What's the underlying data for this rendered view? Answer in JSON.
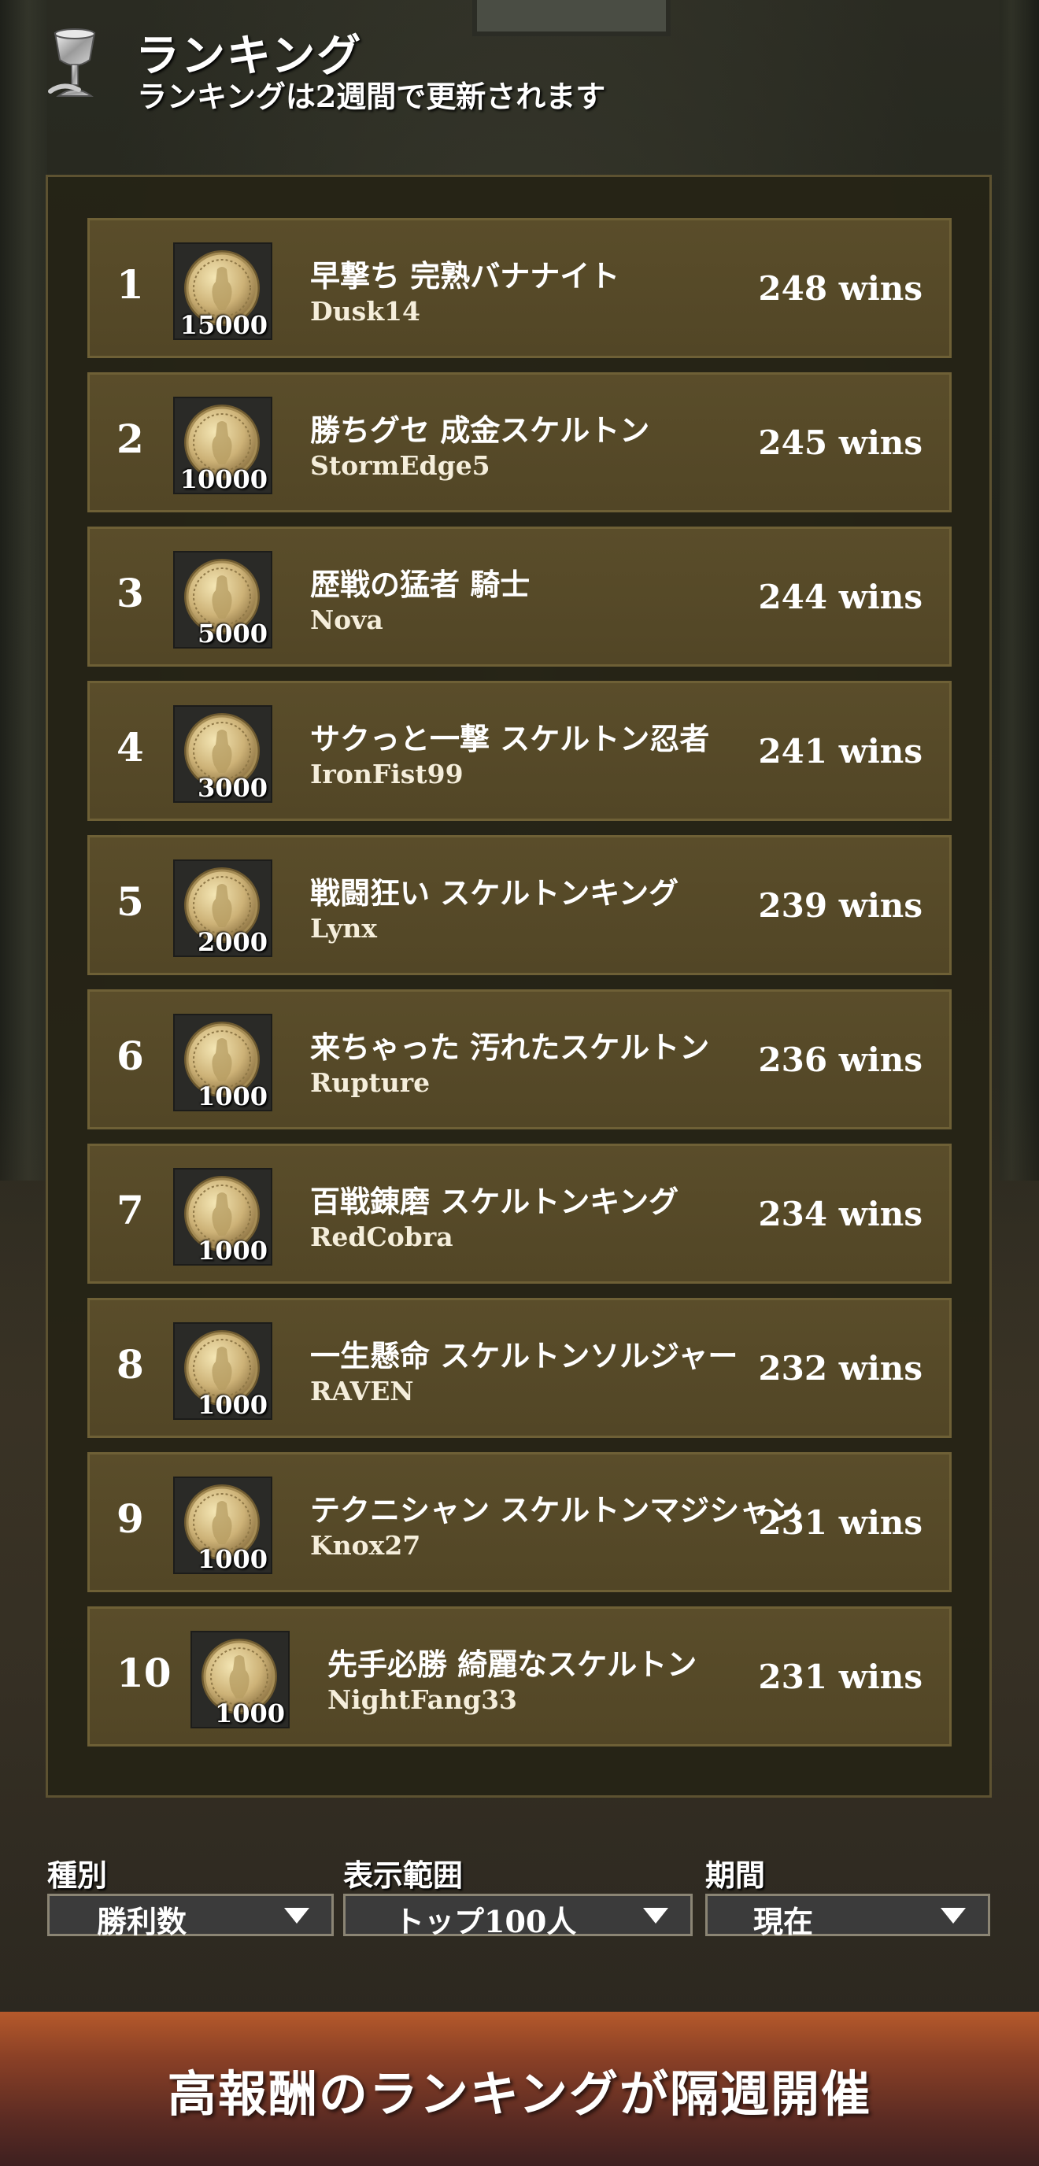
{
  "header": {
    "title": "ランキング",
    "subtitle": "ランキングは2週間で更新されます",
    "icon": "trophy-icon"
  },
  "rankings": [
    {
      "rank": "1",
      "reward": "15000",
      "title": "早撃ち 完熟バナナイト",
      "name": "Dusk14",
      "wins": "248 wins"
    },
    {
      "rank": "2",
      "reward": "10000",
      "title": "勝ちグセ 成金スケルトン",
      "name": "StormEdge5",
      "wins": "245 wins"
    },
    {
      "rank": "3",
      "reward": "5000",
      "title": "歴戦の猛者 騎士",
      "name": "Nova",
      "wins": "244 wins"
    },
    {
      "rank": "4",
      "reward": "3000",
      "title": "サクっと一撃 スケルトン忍者",
      "name": "IronFist99",
      "wins": "241 wins"
    },
    {
      "rank": "5",
      "reward": "2000",
      "title": "戦闘狂い スケルトンキング",
      "name": "Lynx",
      "wins": "239 wins"
    },
    {
      "rank": "6",
      "reward": "1000",
      "title": "来ちゃった 汚れたスケルトン",
      "name": "Rupture",
      "wins": "236 wins"
    },
    {
      "rank": "7",
      "reward": "1000",
      "title": "百戦錬磨 スケルトンキング",
      "name": "RedCobra",
      "wins": "234 wins"
    },
    {
      "rank": "8",
      "reward": "1000",
      "title": "一生懸命 スケルトンソルジャー",
      "name": "RAVEN",
      "wins": "232 wins"
    },
    {
      "rank": "9",
      "reward": "1000",
      "title": "テクニシャン スケルトンマジシャン",
      "name": "Knox27",
      "wins": "231 wins"
    },
    {
      "rank": "10",
      "reward": "1000",
      "title": "先手必勝 綺麗なスケルトン",
      "name": "NightFang33",
      "wins": "231 wins"
    }
  ],
  "filters": {
    "type": {
      "label": "種別",
      "value": "勝利数"
    },
    "range": {
      "label": "表示範囲",
      "value": "トップ100人"
    },
    "period": {
      "label": "期間",
      "value": "現在"
    }
  },
  "banner": {
    "text": "高報酬のランキングが隔週開催"
  },
  "colors": {
    "row_background": "#564a28",
    "row_border": "#6e6036",
    "panel_background": "#26231a",
    "banner_top": "#b5592b",
    "banner_bottom": "#3e2020"
  }
}
